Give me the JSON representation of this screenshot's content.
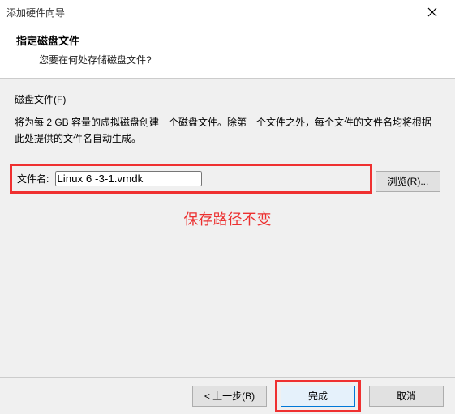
{
  "titlebar": {
    "title": "添加硬件向导"
  },
  "header": {
    "title": "指定磁盘文件",
    "subtitle": "您要在何处存储磁盘文件?"
  },
  "content": {
    "section_label": "磁盘文件(F)",
    "description": "将为每 2 GB 容量的虚拟磁盘创建一个磁盘文件。除第一个文件之外，每个文件的文件名均将根据此处提供的文件名自动生成。",
    "filename_label": "文件名:",
    "filename_value": "Linux 6 -3-1.vmdk",
    "browse_label": "浏览(R)...",
    "annotation": "保存路径不变"
  },
  "footer": {
    "back_label": "< 上一步(B)",
    "finish_label": "完成",
    "cancel_label": "取消"
  }
}
